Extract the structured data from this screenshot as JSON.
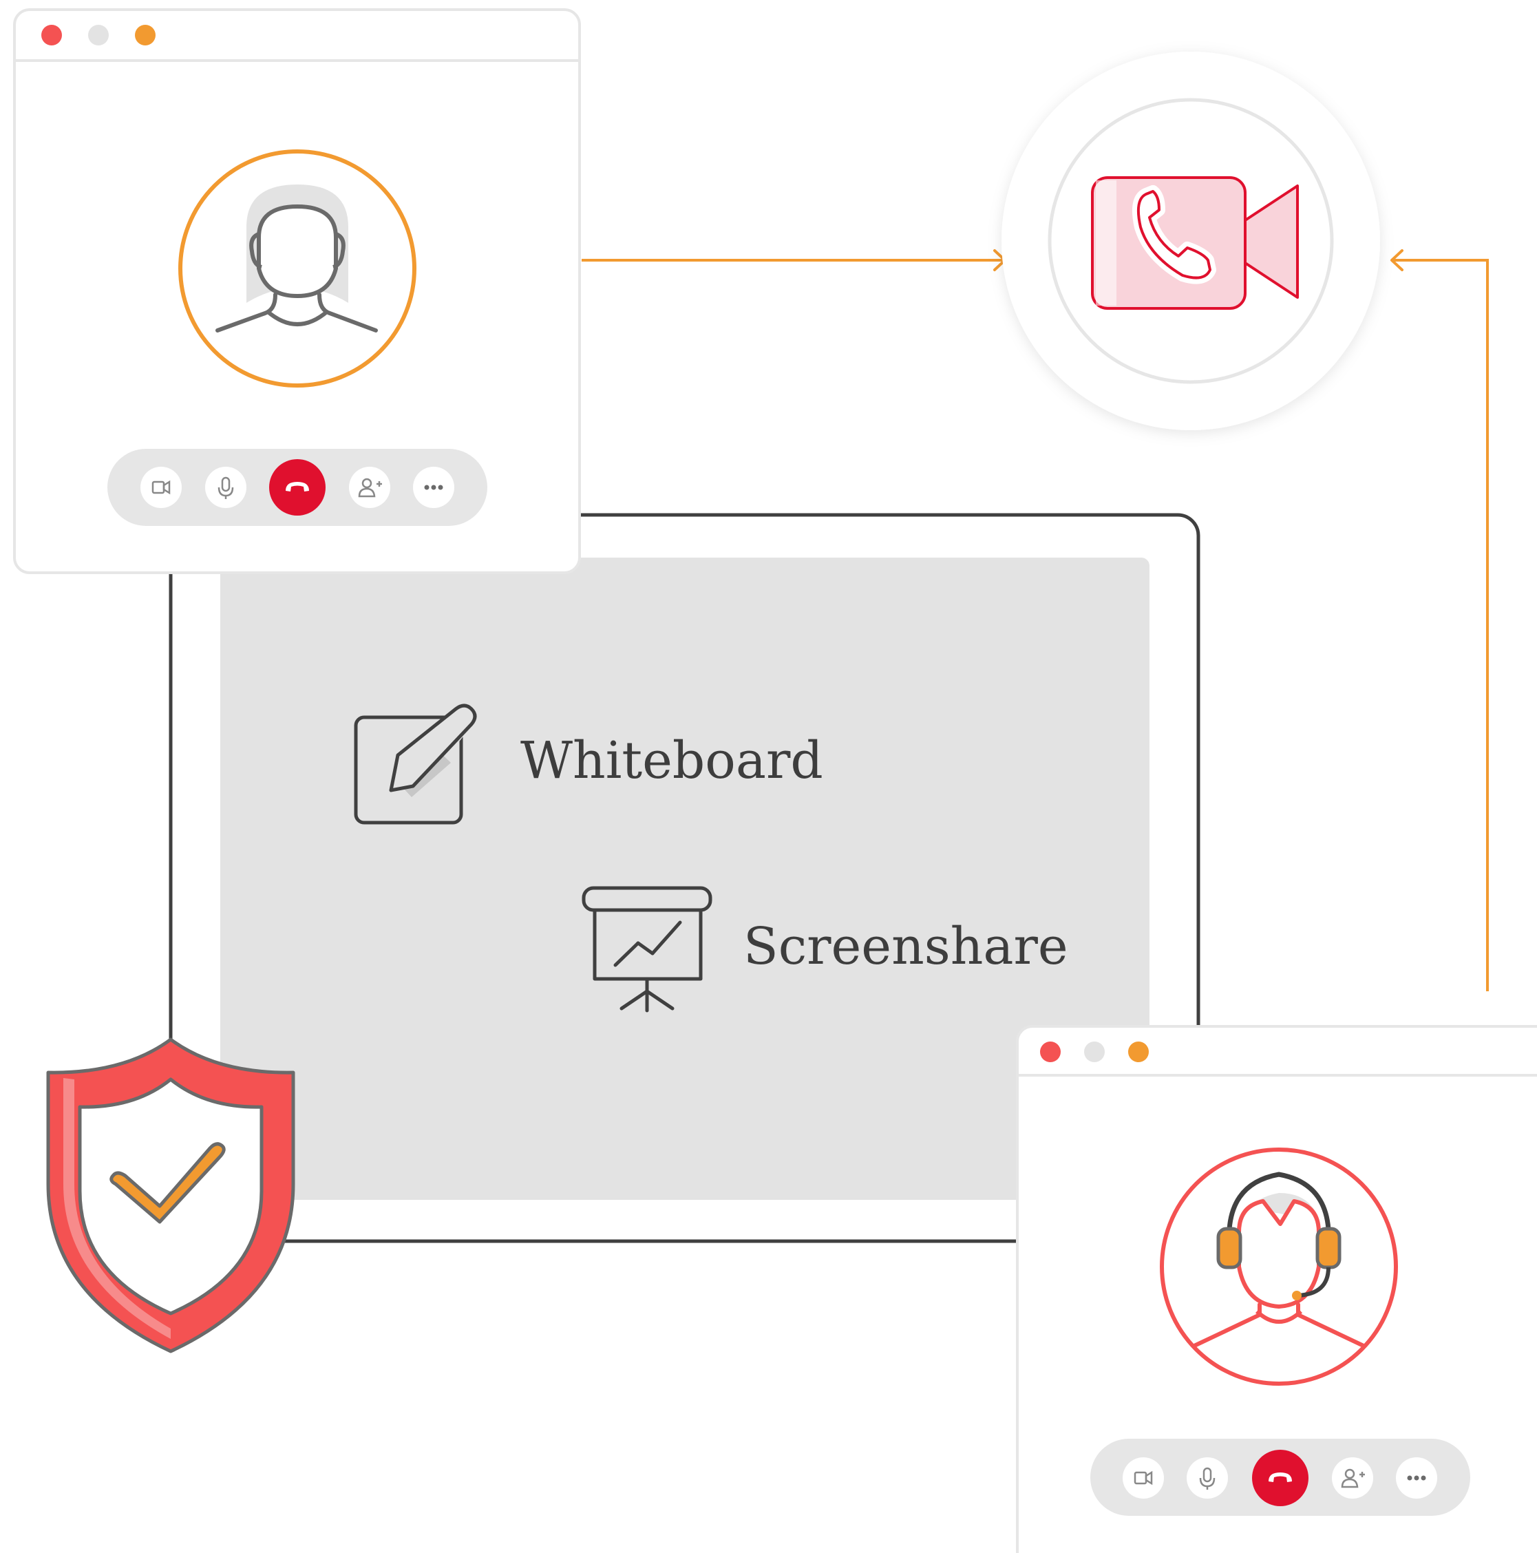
{
  "colors": {
    "red": "#f45252",
    "dark_red": "#e0102e",
    "orange": "#f29a30",
    "gray": "#e6e6e6",
    "dark": "#404040",
    "shield_red": "#f45252",
    "pink": "#f9d3da"
  },
  "board": {
    "whiteboard_label": "Whiteboard",
    "screenshare_label": "Screenshare",
    "whiteboard_icon": "pencil-square-icon",
    "screenshare_icon": "presentation-chart-icon"
  },
  "call_windows": [
    {
      "avatar": "woman-avatar-icon",
      "controls": [
        "video-icon",
        "microphone-icon",
        "end-call-icon",
        "add-user-icon",
        "more-icon"
      ]
    },
    {
      "avatar": "support-agent-headset-icon",
      "controls": [
        "video-icon",
        "microphone-icon",
        "end-call-icon",
        "add-user-icon",
        "more-icon"
      ]
    }
  ],
  "center_icon": "video-call-icon",
  "security_icon": "shield-check-icon"
}
